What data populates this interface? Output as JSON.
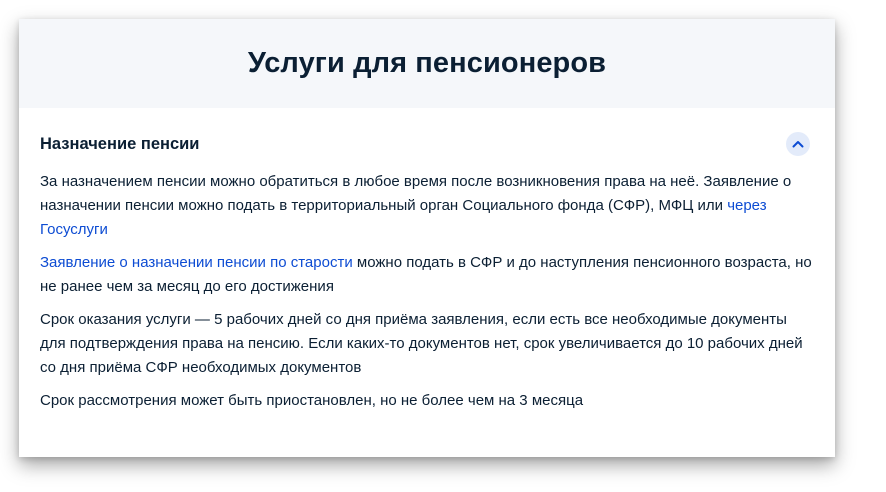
{
  "header": {
    "title": "Услуги для пенсионеров"
  },
  "section": {
    "title": "Назначение пенсии",
    "toggle_icon": "chevron-up-icon",
    "paragraphs": {
      "p1": {
        "text": "За назначением пенсии можно обратиться в любое время после возникновения права на неё. Заявление о назначении пенсии можно подать в территориальный орган Социального фонда (СФР), МФЦ или ",
        "link": "через Госуслуги"
      },
      "p2": {
        "link": "Заявление о назначении пенсии по старости",
        "text": " можно подать в СФР и до наступления пенсионного возраста, но не ранее чем за месяц до его достижения"
      },
      "p3": {
        "text": "Срок оказания услуги — 5 рабочих дней со дня приёма заявления, если есть все необходимые документы для подтверждения права на пенсию. Если каких-то документов нет, срок увеличивается до 10 рабочих дней со дня приёма СФР необходимых документов"
      },
      "p4": {
        "text": "Срок рассмотрения может быть приостановлен, но не более чем на 3 месяца"
      }
    }
  },
  "colors": {
    "text": "#0b1f33",
    "link": "#0d4cd3",
    "header_bg": "#f5f7fa",
    "toggle_bg": "#e3ebfa"
  }
}
